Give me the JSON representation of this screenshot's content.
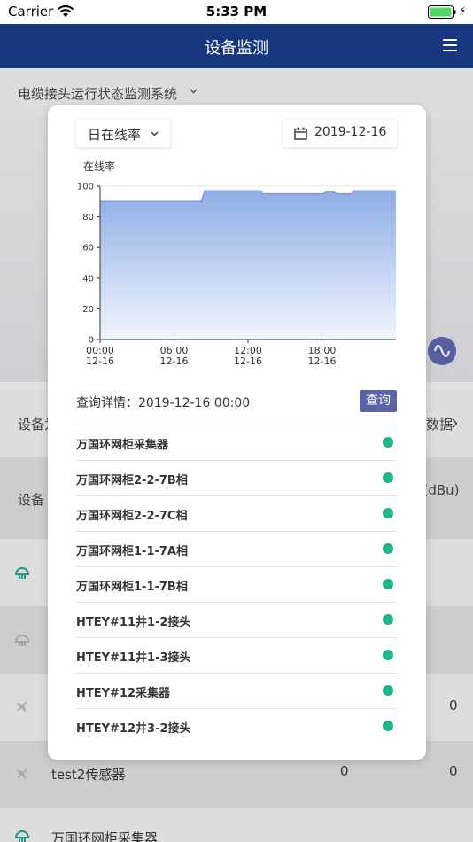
{
  "status_bar": {
    "carrier": "Carrier",
    "time": "5:33 PM"
  },
  "nav": {
    "title": "设备监测",
    "menu_icon": "hamburger-menu-icon"
  },
  "background": {
    "system_select": "电缆接头运行状态监测系统",
    "row_a_left": "设备为",
    "row_a_right": "数据",
    "row_b_left": "设备",
    "row_b_right": "E(dBu)",
    "rows": [
      {
        "icon": "umbrella-sensor-icon",
        "name": "",
        "val1": "",
        "val2": ""
      },
      {
        "icon": "umbrella-sensor-icon",
        "name": "",
        "val1": "",
        "val2": ""
      },
      {
        "icon": "signal-sensor-icon",
        "name": "",
        "val1": "",
        "val2": "0"
      },
      {
        "icon": "signal-sensor-icon",
        "name": "test2传感器",
        "val1": "0",
        "val2": "0"
      },
      {
        "icon": "umbrella-sensor-icon",
        "name": "万国环网柜采集器",
        "val1": "",
        "val2": ""
      }
    ],
    "accent": "#17387e",
    "button_color": "#5a63a6"
  },
  "modal": {
    "select_label": "日在线率",
    "date": "2019-12-16",
    "query_label": "查询详情：2019-12-16 00:00",
    "query_button": "查询",
    "status_color": "#1fb58f",
    "devices": [
      {
        "name": "万国环网柜采集器",
        "status": "online"
      },
      {
        "name": "万国环网柜2-2-7B相",
        "status": "online"
      },
      {
        "name": "万国环网柜2-2-7C相",
        "status": "online"
      },
      {
        "name": "万国环网柜1-1-7A相",
        "status": "online"
      },
      {
        "name": "万国环网柜1-1-7B相",
        "status": "online"
      },
      {
        "name": "HTEY#11井1-2接头",
        "status": "online"
      },
      {
        "name": "HTEY#11井1-3接头",
        "status": "online"
      },
      {
        "name": "HTEY#12采集器",
        "status": "online"
      },
      {
        "name": "HTEY#12井3-2接头",
        "status": "online"
      }
    ]
  },
  "chart_data": {
    "type": "area",
    "ylabel": "在线率",
    "ylim": [
      0,
      100
    ],
    "yticks": [
      0,
      20,
      40,
      60,
      80,
      100
    ],
    "xticks": [
      {
        "hour": 0,
        "time": "00:00",
        "date": "12-16"
      },
      {
        "hour": 6,
        "time": "06:00",
        "date": "12-16"
      },
      {
        "hour": 12,
        "time": "12:00",
        "date": "12-16"
      },
      {
        "hour": 18,
        "time": "18:00",
        "date": "12-16"
      }
    ],
    "xlim": [
      0,
      24
    ],
    "x": [
      0,
      8.2,
      8.5,
      13.0,
      13.2,
      18.1,
      18.3,
      19.0,
      19.2,
      20.4,
      20.6,
      24
    ],
    "y": [
      90,
      90,
      97,
      97,
      95,
      95,
      96,
      96,
      95,
      95,
      97,
      97
    ],
    "fill_top": "#8faee6",
    "fill_bottom": "#f1f5fd",
    "line": "#7c9bd6",
    "grid": true
  }
}
